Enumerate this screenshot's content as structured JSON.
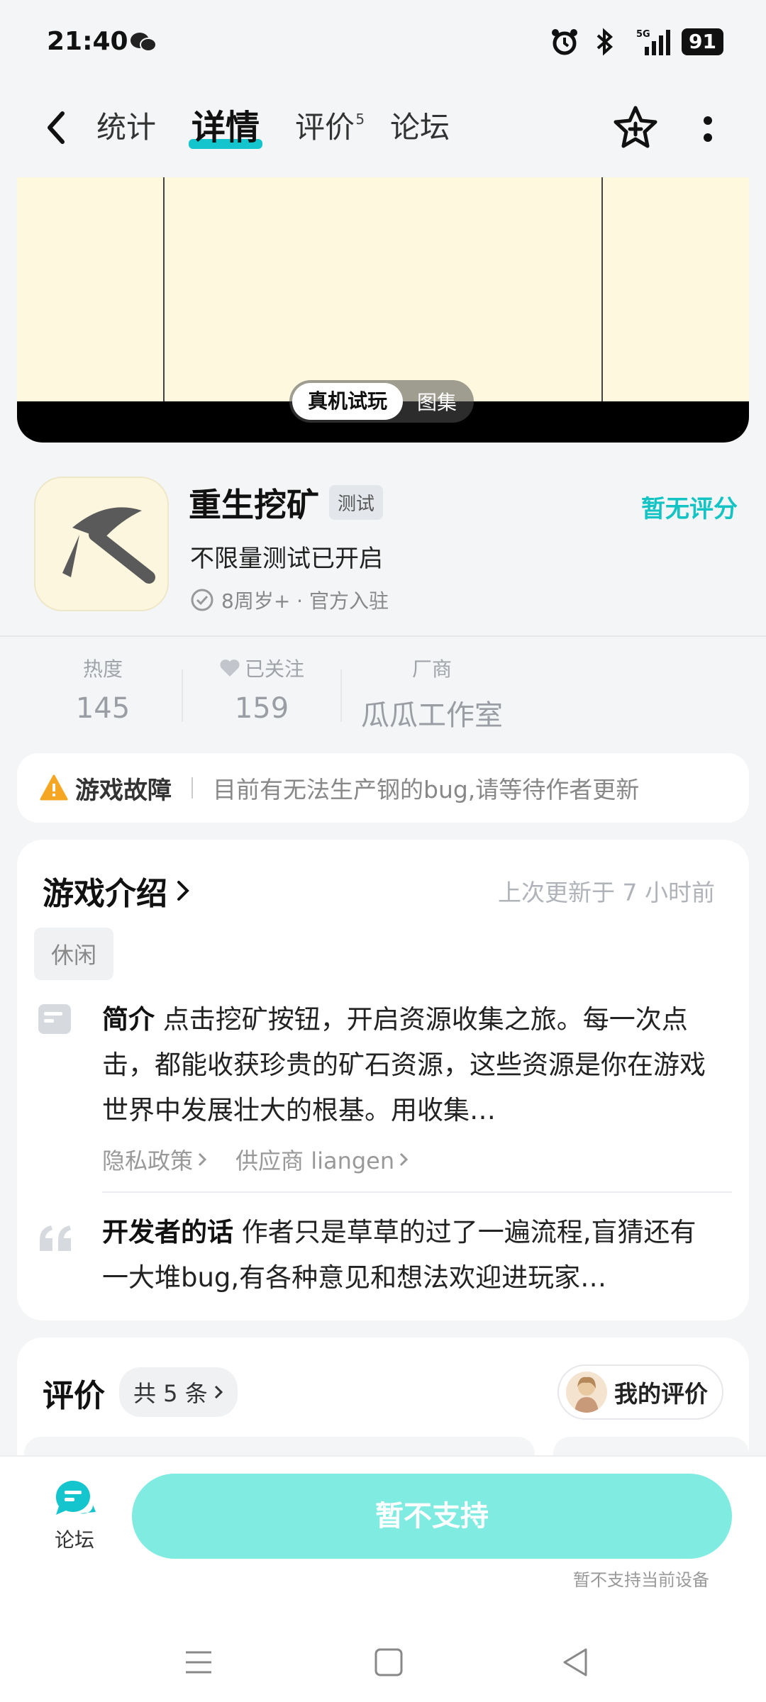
{
  "status_bar": {
    "time": "21:40",
    "battery": "91",
    "network": "5G"
  },
  "header": {
    "tabs": [
      {
        "label": "统计"
      },
      {
        "label": "详情"
      },
      {
        "label": "评价",
        "badge": "5"
      },
      {
        "label": "论坛"
      }
    ],
    "active_tab": "详情"
  },
  "media": {
    "toggle_active": "真机试玩",
    "toggle_inactive": "图集"
  },
  "game": {
    "title": "重生挖矿",
    "badge": "测试",
    "rating": "暂无评分",
    "subtitle": "不限量测试已开启",
    "meta": "8周岁+ · 官方入驻"
  },
  "stats": {
    "heat_label": "热度",
    "heat_value": "145",
    "follow_label": "已关注",
    "follow_value": "159",
    "vendor_label": "厂商",
    "vendor_value": "瓜瓜工作室"
  },
  "notice": {
    "title": "游戏故障",
    "text": "目前有无法生产钢的bug,请等待作者更新"
  },
  "intro": {
    "title": "游戏介绍",
    "updated": "上次更新于 7 小时前",
    "tag": "休闲",
    "desc_label": "简介",
    "desc_text": "点击挖矿按钮，开启资源收集之旅。每一次点击，都能收获珍贵的矿石资源，这些资源是你在游戏世界中发展壮大的根基。用收集…",
    "privacy_link": "隐私政策",
    "supplier_link": "供应商 liangen",
    "dev_label": "开发者的话",
    "dev_text": "作者只是草草的过了一遍流程,盲猜还有一大堆bug,有各种意见和想法欢迎进玩家…"
  },
  "reviews": {
    "title": "评价",
    "count": "共 5 条",
    "my_review": "我的评价"
  },
  "bottom": {
    "forum_label": "论坛",
    "install_label": "暂不支持",
    "install_note": "暂不支持当前设备"
  },
  "colors": {
    "accent": "#15c5ce",
    "rating": "#14c4c4",
    "button": "#80ebe1",
    "warning": "#f5a623"
  }
}
